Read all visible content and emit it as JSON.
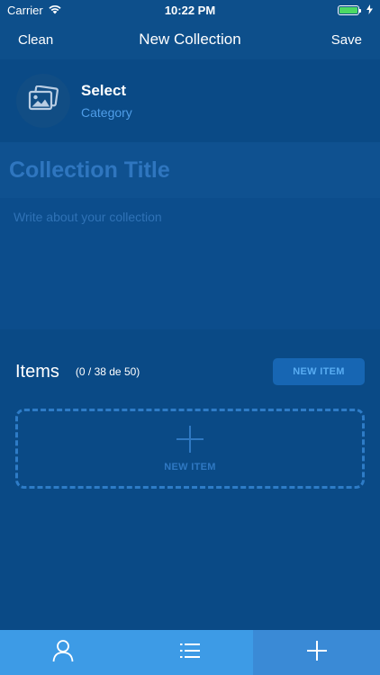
{
  "status_bar": {
    "carrier": "Carrier",
    "time": "10:22 PM",
    "wifi_icon": "wifi-icon",
    "battery_icon": "battery-icon",
    "charging_icon": "bolt-icon"
  },
  "nav": {
    "left_label": "Clean",
    "title": "New Collection",
    "right_label": "Save"
  },
  "category": {
    "icon": "images-icon",
    "title": "Select",
    "subtitle": "Category"
  },
  "form": {
    "title_placeholder": "Collection Title",
    "description_placeholder": "Write about your collection"
  },
  "items": {
    "label": "Items",
    "count": "(0 / 38 de 50)",
    "new_item_button": "NEW ITEM",
    "add_box_label": "NEW ITEM"
  },
  "tabs": [
    {
      "icon": "user-icon",
      "active": false
    },
    {
      "icon": "list-icon",
      "active": false
    },
    {
      "icon": "plus-icon",
      "active": true
    }
  ],
  "colors": {
    "background": "#0a4a86",
    "accent": "#3d9be6",
    "link": "#4f9de8",
    "battery": "#4cd964"
  }
}
